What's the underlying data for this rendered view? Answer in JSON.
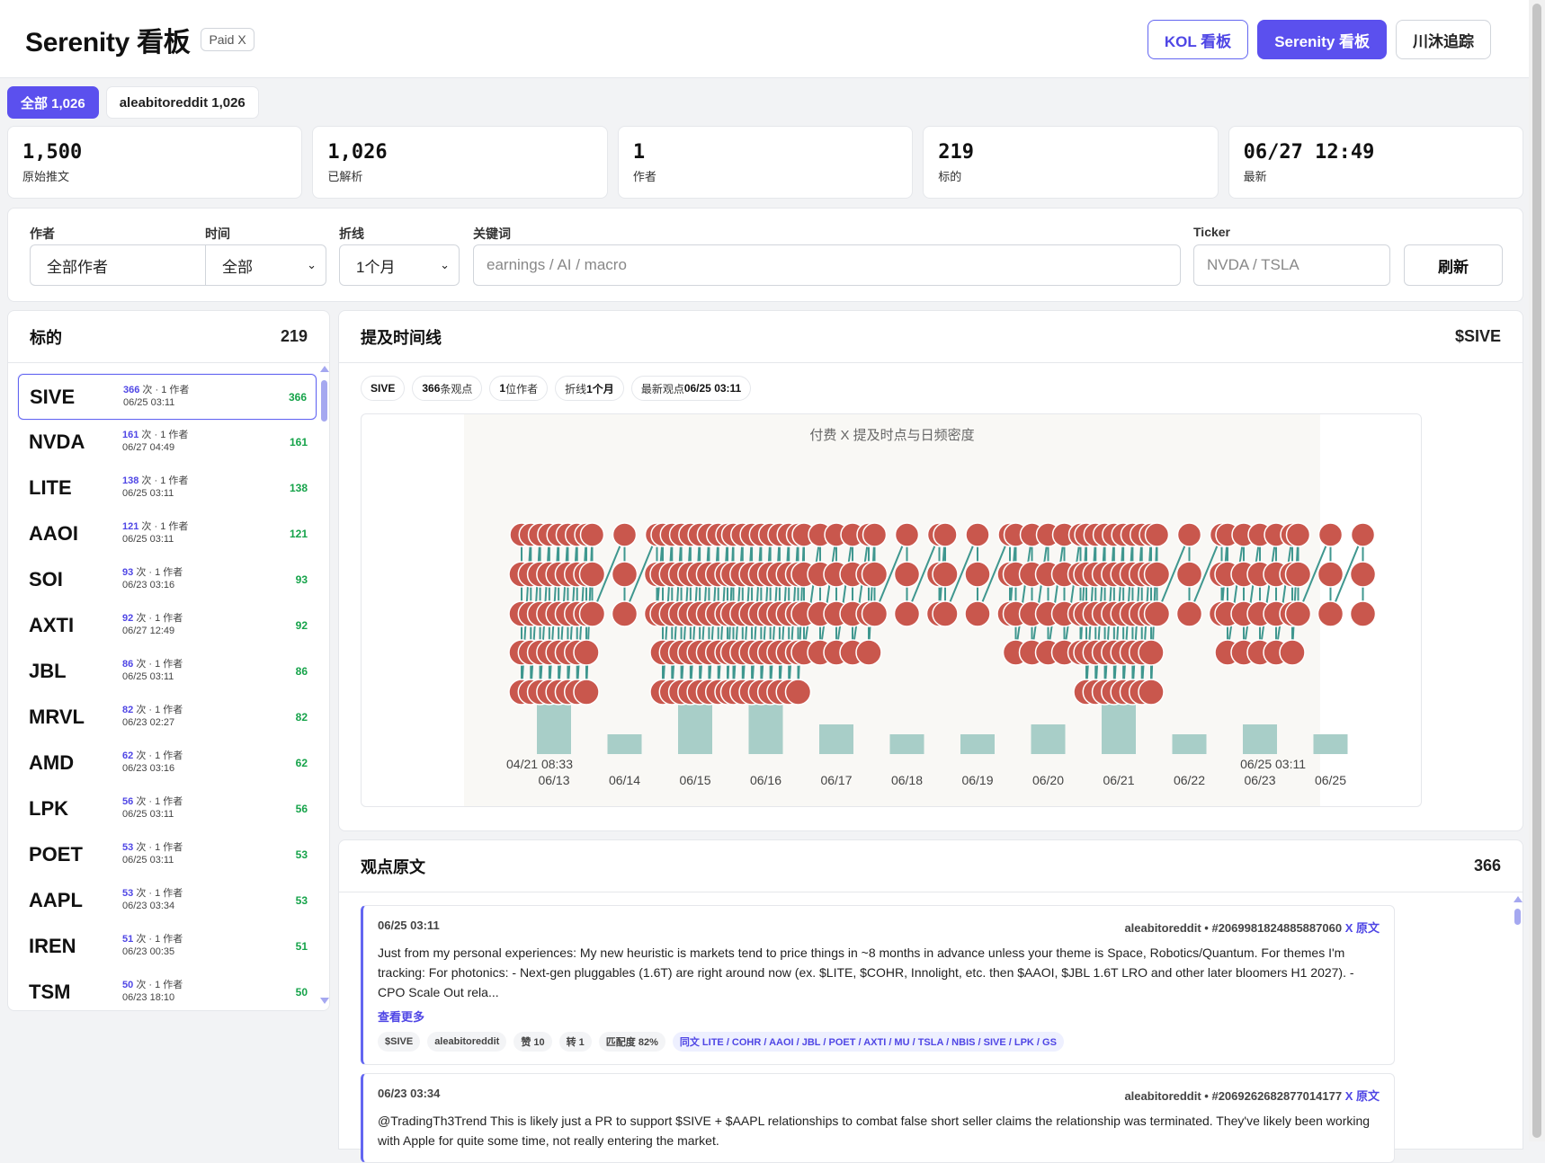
{
  "header": {
    "title": "Serenity 看板",
    "badge": "Paid X",
    "nav": [
      "KOL 看板",
      "Serenity 看板",
      "川沐追踪"
    ]
  },
  "author_chips": [
    {
      "label": "全部 1,026"
    },
    {
      "label": "aleabitoreddit 1,026"
    }
  ],
  "stats": [
    {
      "value": "1,500",
      "label": "原始推文"
    },
    {
      "value": "1,026",
      "label": "已解析"
    },
    {
      "value": "1",
      "label": "作者"
    },
    {
      "value": "219",
      "label": "标的"
    },
    {
      "value": "06/27 12:49",
      "label": "最新"
    }
  ],
  "filters": {
    "author_label": "作者",
    "author_value": "全部作者",
    "time_label": "时间",
    "time_value": "全部",
    "line_label": "折线",
    "line_value": "1个月",
    "keyword_label": "关键词",
    "keyword_placeholder": "earnings / AI / macro",
    "ticker_label": "Ticker",
    "ticker_placeholder": "NVDA / TSLA",
    "refresh": "刷新"
  },
  "tickers_panel": {
    "title": "标的",
    "count": "219",
    "items": [
      {
        "sym": "SIVE",
        "n": "366",
        "meta": "次 · 1 作者",
        "time": "06/25 03:11",
        "count": "366"
      },
      {
        "sym": "NVDA",
        "n": "161",
        "meta": "次 · 1 作者",
        "time": "06/27 04:49",
        "count": "161"
      },
      {
        "sym": "LITE",
        "n": "138",
        "meta": "次 · 1 作者",
        "time": "06/25 03:11",
        "count": "138"
      },
      {
        "sym": "AAOI",
        "n": "121",
        "meta": "次 · 1 作者",
        "time": "06/25 03:11",
        "count": "121"
      },
      {
        "sym": "SOI",
        "n": "93",
        "meta": "次 · 1 作者",
        "time": "06/23 03:16",
        "count": "93"
      },
      {
        "sym": "AXTI",
        "n": "92",
        "meta": "次 · 1 作者",
        "time": "06/27 12:49",
        "count": "92"
      },
      {
        "sym": "JBL",
        "n": "86",
        "meta": "次 · 1 作者",
        "time": "06/25 03:11",
        "count": "86"
      },
      {
        "sym": "MRVL",
        "n": "82",
        "meta": "次 · 1 作者",
        "time": "06/23 02:27",
        "count": "82"
      },
      {
        "sym": "AMD",
        "n": "62",
        "meta": "次 · 1 作者",
        "time": "06/23 03:16",
        "count": "62"
      },
      {
        "sym": "LPK",
        "n": "56",
        "meta": "次 · 1 作者",
        "time": "06/25 03:11",
        "count": "56"
      },
      {
        "sym": "POET",
        "n": "53",
        "meta": "次 · 1 作者",
        "time": "06/25 03:11",
        "count": "53"
      },
      {
        "sym": "AAPL",
        "n": "53",
        "meta": "次 · 1 作者",
        "time": "06/23 03:34",
        "count": "53"
      },
      {
        "sym": "IREN",
        "n": "51",
        "meta": "次 · 1 作者",
        "time": "06/23 00:35",
        "count": "51"
      },
      {
        "sym": "TSM",
        "n": "50",
        "meta": "次 · 1 作者",
        "time": "06/23 18:10",
        "count": "50"
      }
    ]
  },
  "timeline": {
    "title": "提及时间线",
    "ticker": "$SIVE",
    "pills": [
      {
        "pre": "",
        "bold": "SIVE",
        "post": ""
      },
      {
        "pre": "",
        "bold": "366",
        "post": "条观点"
      },
      {
        "pre": "",
        "bold": "1",
        "post": "位作者"
      },
      {
        "pre": "折线",
        "bold": "1个月",
        "post": ""
      },
      {
        "pre": "最新观点",
        "bold": "06/25 03:11",
        "post": ""
      }
    ]
  },
  "chart_data": {
    "type": "bar",
    "title": "付费 X 提及时点与日频密度",
    "categories": [
      "06/13",
      "06/14",
      "06/15",
      "06/16",
      "06/17",
      "06/18",
      "06/19",
      "06/20",
      "06/21",
      "06/22",
      "06/23",
      "06/25"
    ],
    "values": [
      5,
      2,
      5,
      5,
      3,
      2,
      2,
      3,
      5,
      2,
      3,
      2
    ],
    "start_label": "04/21 08:33",
    "end_label": "06/25 03:11",
    "colors": {
      "bar": "#a8cec8",
      "dot": "#c9574d",
      "line": "#3f978f",
      "bg": "#f9f8f5"
    }
  },
  "posts_panel": {
    "title": "观点原文",
    "count": "366",
    "posts": [
      {
        "time": "06/25 03:11",
        "author": "aleabitoreddit • #2069981824885887060",
        "link": "X 原文",
        "body": "Just from my personal experiences: My new heuristic is markets tend to price things in ~8 months in advance unless your theme is Space, Robotics/Quantum. For themes I'm tracking: For photonics: - Next-gen pluggables (1.6T) are right around now (ex. $LITE, $COHR, Innolight, etc. then $AAOI, $JBL 1.6T LRO and other later bloomers H1 2027). - CPO Scale Out rela...",
        "more": "查看更多",
        "tags": [
          "$SIVE",
          "aleabitoreddit",
          "赞 10",
          "转 1",
          "匹配度 82%"
        ],
        "peers": "同文 LITE / COHR / AAOI / JBL / POET / AXTI / MU / TSLA / NBIS / SIVE / LPK / GS"
      },
      {
        "time": "06/23 03:34",
        "author": "aleabitoreddit • #2069262682877014177",
        "link": "X 原文",
        "body": "@TradingTh3Trend This is likely just a PR to support $SIVE + $AAPL relationships to combat false short seller claims the relationship was terminated. They've likely been working with Apple for quite some time, not really entering the market."
      }
    ]
  }
}
